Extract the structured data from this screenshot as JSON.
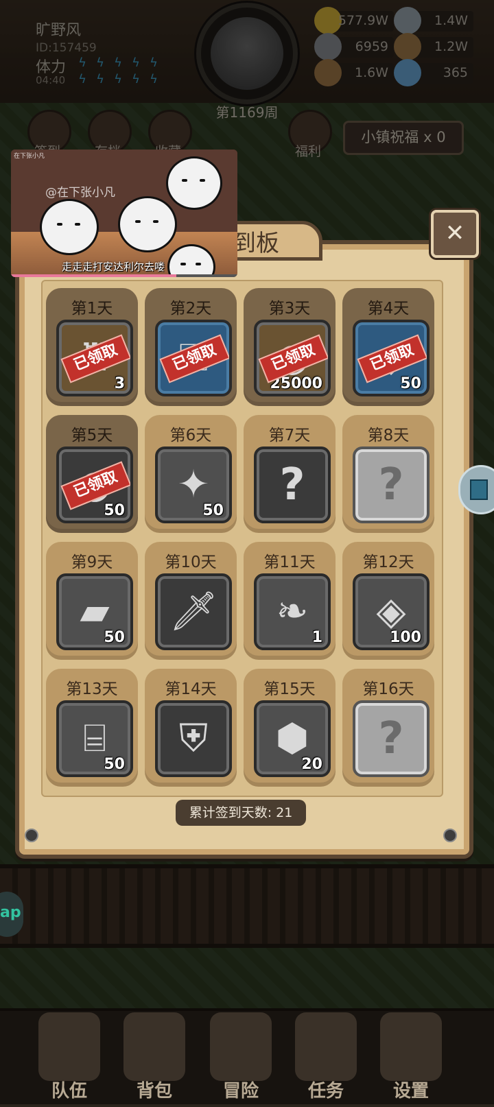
{
  "player": {
    "name": "旷野风",
    "id": "ID:157459",
    "stamina_label": "体力",
    "stamina_timer": "04:40"
  },
  "week": "第1169周",
  "resources": [
    {
      "icon": "gold-coin-icon",
      "value": "577.9W",
      "color": "#d6b23a"
    },
    {
      "icon": "silver-ingot-icon",
      "value": "1.4W",
      "color": "#9aa7b0"
    },
    {
      "icon": "ore-icon",
      "value": "6959",
      "color": "#8a8f94"
    },
    {
      "icon": "map-scroll-icon",
      "value": "1.2W",
      "color": "#a07a4a"
    },
    {
      "icon": "wood-log-icon",
      "value": "1.6W",
      "color": "#a07848"
    },
    {
      "icon": "blue-crystal-icon",
      "value": "365",
      "color": "#6aa8d8"
    }
  ],
  "top_icons": [
    {
      "label": "签到",
      "name": "checkin-icon"
    },
    {
      "label": "存档",
      "name": "archive-icon"
    },
    {
      "label": "收藏",
      "name": "collection-icon"
    },
    {
      "label": "福利",
      "name": "welfare-icon"
    }
  ],
  "blessing": "小镇祝福 x 0",
  "video": {
    "watermark": "@在下张小凡",
    "tiny_watermark": "在下张小凡",
    "subtitle": "走走走打安达利尔去喽",
    "progress": 0.73
  },
  "panel": {
    "title": "到板",
    "total_label": "累计签到天数: 21",
    "claimed_stamp": "已领取"
  },
  "days": [
    {
      "label": "第1天",
      "glyph": "♜",
      "qty": "3",
      "claimed": true,
      "style": "gold",
      "icon": "potion-icon"
    },
    {
      "label": "第2天",
      "glyph": "⚿",
      "qty": "",
      "claimed": true,
      "style": "blue",
      "icon": "key-icon"
    },
    {
      "label": "第3天",
      "glyph": "◎",
      "qty": "25000",
      "claimed": true,
      "style": "gold",
      "icon": "gold-bag-icon"
    },
    {
      "label": "第4天",
      "glyph": "◆",
      "qty": "50",
      "claimed": true,
      "style": "blue",
      "icon": "blue-crystal-icon"
    },
    {
      "label": "第5天",
      "glyph": "●",
      "qty": "50",
      "claimed": true,
      "style": "dark",
      "icon": "ore-icon"
    },
    {
      "label": "第6天",
      "glyph": "✦",
      "qty": "50",
      "claimed": false,
      "style": "",
      "icon": "map-scroll-icon"
    },
    {
      "label": "第7天",
      "glyph": "?",
      "qty": "",
      "claimed": false,
      "style": "dark",
      "icon": "mystery-icon"
    },
    {
      "label": "第8天",
      "glyph": "?",
      "qty": "",
      "claimed": false,
      "style": "light",
      "icon": "mystery-icon"
    },
    {
      "label": "第9天",
      "glyph": "▰",
      "qty": "50",
      "claimed": false,
      "style": "",
      "icon": "silver-ingot-icon"
    },
    {
      "label": "第10天",
      "glyph": "🗡",
      "qty": "",
      "claimed": false,
      "style": "dark",
      "icon": "sword-icon"
    },
    {
      "label": "第11天",
      "glyph": "❧",
      "qty": "1",
      "claimed": false,
      "style": "",
      "icon": "feather-icon"
    },
    {
      "label": "第12天",
      "glyph": "◈",
      "qty": "100",
      "claimed": false,
      "style": "",
      "icon": "rune-stone-icon"
    },
    {
      "label": "第13天",
      "glyph": "⌸",
      "qty": "50",
      "claimed": false,
      "style": "",
      "icon": "wood-log-icon"
    },
    {
      "label": "第14天",
      "glyph": "⛨",
      "qty": "",
      "claimed": false,
      "style": "dark",
      "icon": "backpack-icon"
    },
    {
      "label": "第15天",
      "glyph": "⬢",
      "qty": "20",
      "claimed": false,
      "style": "",
      "icon": "emblem-stone-icon"
    },
    {
      "label": "第16天",
      "glyph": "?",
      "qty": "",
      "claimed": false,
      "style": "light",
      "icon": "mystery-icon"
    }
  ],
  "nav": [
    {
      "label": "队伍",
      "name": "team"
    },
    {
      "label": "背包",
      "name": "backpack"
    },
    {
      "label": "冒险",
      "name": "adventure"
    },
    {
      "label": "任务",
      "name": "quest"
    },
    {
      "label": "设置",
      "name": "settings"
    }
  ],
  "side_left_text": "ap"
}
